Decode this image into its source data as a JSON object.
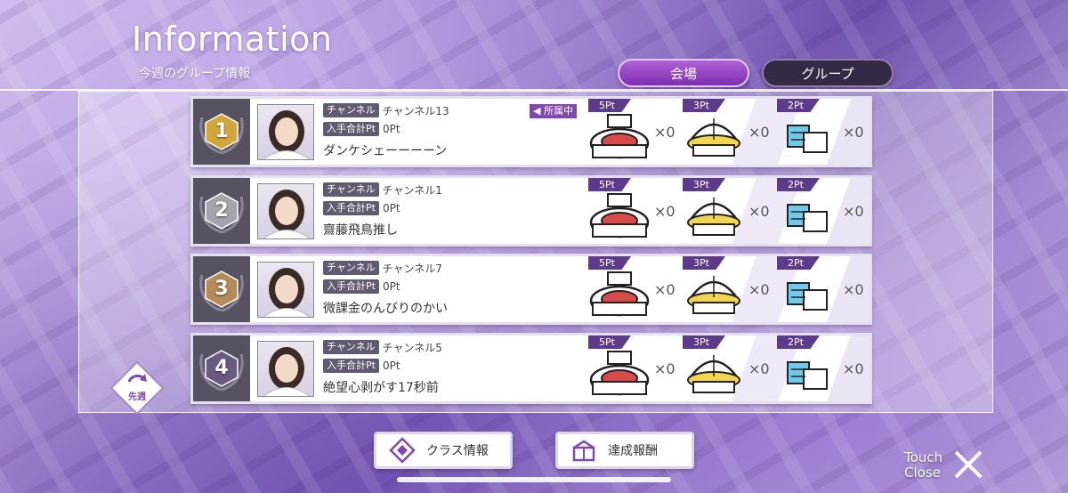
{
  "header": {
    "title": "Information",
    "subtitle": "今週のグループ情報"
  },
  "tabs": [
    {
      "label": "会場",
      "active": true
    },
    {
      "label": "グループ",
      "active": false
    }
  ],
  "labels": {
    "channel": "チャンネル",
    "points": "入手合計Pt",
    "belonging": "◀ 所属中"
  },
  "venue_points": [
    "5Pt",
    "3Pt",
    "2Pt"
  ],
  "rows": [
    {
      "rank": "1",
      "channel": "チャンネル13",
      "pt": "0Pt",
      "name": "ダンケシェーーーーン",
      "counts": [
        "×0",
        "×0",
        "×0"
      ],
      "belonging": true,
      "medal": "#d2a63a"
    },
    {
      "rank": "2",
      "channel": "チャンネル1",
      "pt": "0Pt",
      "name": "齋藤飛鳥推し",
      "counts": [
        "×0",
        "×0",
        "×0"
      ],
      "belonging": false,
      "medal": "#a7a3ad"
    },
    {
      "rank": "3",
      "channel": "チャンネル7",
      "pt": "0Pt",
      "name": "微課金のんびりのかい",
      "counts": [
        "×0",
        "×0",
        "×0"
      ],
      "belonging": false,
      "medal": "#b58a5a"
    },
    {
      "rank": "4",
      "channel": "チャンネル5",
      "pt": "0Pt",
      "name": "絶望心剥がす17秒前",
      "counts": [
        "×0",
        "×0",
        "×0"
      ],
      "belonging": false,
      "medal": "#6b5a80"
    }
  ],
  "prev_week": {
    "label": "先週"
  },
  "footer": {
    "class_info": "クラス情報",
    "rewards": "達成報酬",
    "close_line1": "Touch",
    "close_line2": "Close"
  },
  "colors": {
    "accent": "#8247b0",
    "tab_active": "#9c4cc8",
    "tab_inactive": "#352a45"
  }
}
